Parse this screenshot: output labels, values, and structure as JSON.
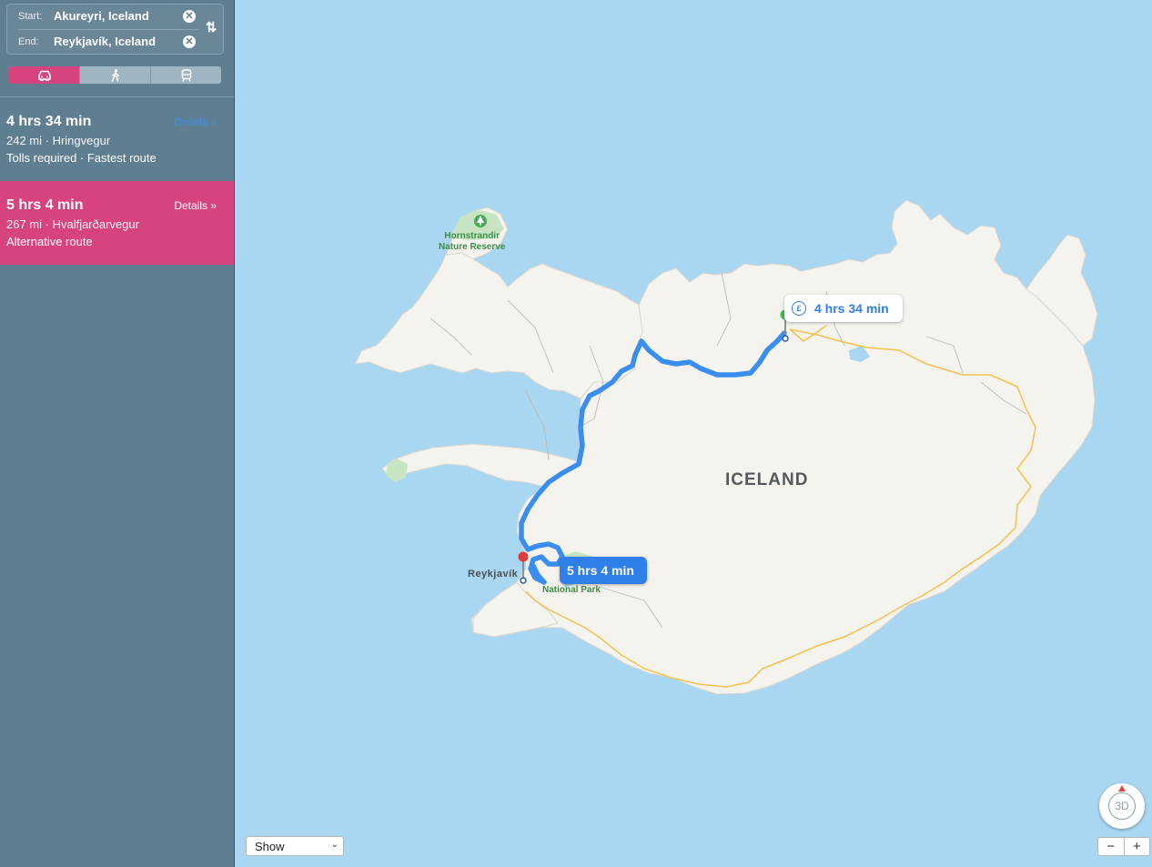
{
  "directions": {
    "start_label": "Start:",
    "start_value": "Akureyri, Iceland",
    "end_label": "End:",
    "end_value": "Reykjavík, Iceland"
  },
  "transport_modes": [
    {
      "name": "car-icon",
      "active": true
    },
    {
      "name": "walking-icon",
      "active": false
    },
    {
      "name": "transit-icon",
      "active": false
    }
  ],
  "routes": [
    {
      "time": "4 hrs 34 min",
      "distance": "242 mi · Hringvegur",
      "note": "Tolls required · Fastest route",
      "details": "Details »"
    },
    {
      "time": "5 hrs 4 min",
      "distance": "267 mi · Hvalfjarðarvegur",
      "note": "Alternative route",
      "details": "Details »",
      "selected": true
    }
  ],
  "map": {
    "country_label": "ICELAND",
    "city_label": "Reykjavík",
    "poi_hornstrandir": "Hornstrandir\nNature Reserve",
    "poi_park": "National Park",
    "callout_fast": "4 hrs 34 min",
    "callout_alt": "5 hrs 4 min",
    "currency_symbol": "£"
  },
  "controls": {
    "show_select": "Show",
    "compass_label": "3D",
    "zoom_out": "−",
    "zoom_in": "+"
  },
  "colors": {
    "accent": "#d6437f",
    "route_blue": "#3a8ef0",
    "sidebar": "#5f7e8f",
    "water": "#a9d6f0",
    "land": "#f5f3ed"
  }
}
